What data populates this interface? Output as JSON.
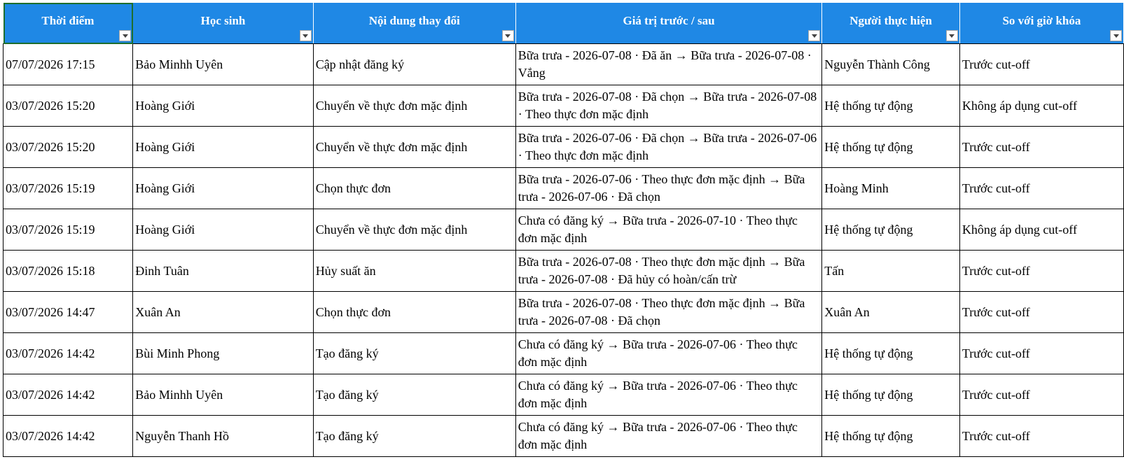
{
  "columns": [
    "Thời điểm",
    "Học sinh",
    "Nội dung thay đổi",
    "Giá trị trước / sau",
    "Người thực hiện",
    "So với giờ khóa"
  ],
  "icons": {
    "filter": "filter-dropdown-icon"
  },
  "colors": {
    "header_bg": "#1f88e5",
    "header_text": "#ffffff",
    "selected_cell_border": "#1e6e2e"
  },
  "rows": [
    [
      "07/07/2026 17:15",
      "Bảo Minhh Uyên",
      "Cập nhật đăng ký",
      "Bữa trưa - 2026-07-08 · Đã ăn → Bữa trưa - 2026-07-08 · Vắng",
      "Nguyễn Thành Công",
      "Trước cut-off"
    ],
    [
      "03/07/2026 15:20",
      "Hoàng Giới",
      "Chuyển về thực đơn mặc định",
      "Bữa trưa - 2026-07-08 · Đã chọn → Bữa trưa - 2026-07-08 · Theo thực đơn mặc định",
      "Hệ thống tự động",
      "Không áp dụng cut-off"
    ],
    [
      "03/07/2026 15:20",
      "Hoàng Giới",
      "Chuyển về thực đơn mặc định",
      "Bữa trưa - 2026-07-06 · Đã chọn → Bữa trưa - 2026-07-06 · Theo thực đơn mặc định",
      "Hệ thống tự động",
      "Trước cut-off"
    ],
    [
      "03/07/2026 15:19",
      "Hoàng Giới",
      "Chọn thực đơn",
      "Bữa trưa - 2026-07-06 · Theo thực đơn mặc định → Bữa trưa - 2026-07-06 · Đã chọn",
      "Hoàng Minh",
      "Trước cut-off"
    ],
    [
      "03/07/2026 15:19",
      "Hoàng Giới",
      "Chuyển về thực đơn mặc định",
      "Chưa có đăng ký → Bữa trưa - 2026-07-10 · Theo thực đơn mặc định",
      "Hệ thống tự động",
      "Không áp dụng cut-off"
    ],
    [
      "03/07/2026 15:18",
      "Đinh Tuân",
      "Hủy suất ăn",
      "Bữa trưa - 2026-07-08 · Theo thực đơn mặc định → Bữa trưa - 2026-07-08 · Đã hủy có hoàn/cấn trừ",
      "Tấn",
      "Trước cut-off"
    ],
    [
      "03/07/2026 14:47",
      "Xuân An",
      "Chọn thực đơn",
      "Bữa trưa - 2026-07-08 · Theo thực đơn mặc định → Bữa trưa - 2026-07-08 · Đã chọn",
      "Xuân An",
      "Trước cut-off"
    ],
    [
      "03/07/2026 14:42",
      "Bùi Minh Phong",
      "Tạo đăng ký",
      "Chưa có đăng ký → Bữa trưa - 2026-07-06 · Theo thực đơn mặc định",
      "Hệ thống tự động",
      "Trước cut-off"
    ],
    [
      "03/07/2026 14:42",
      "Bảo Minhh Uyên",
      "Tạo đăng ký",
      "Chưa có đăng ký → Bữa trưa - 2026-07-06 · Theo thực đơn mặc định",
      "Hệ thống tự động",
      "Trước cut-off"
    ],
    [
      "03/07/2026 14:42",
      "Nguyễn Thanh Hồ",
      "Tạo đăng ký",
      "Chưa có đăng ký → Bữa trưa - 2026-07-06 · Theo thực đơn mặc định",
      "Hệ thống tự động",
      "Trước cut-off"
    ]
  ]
}
